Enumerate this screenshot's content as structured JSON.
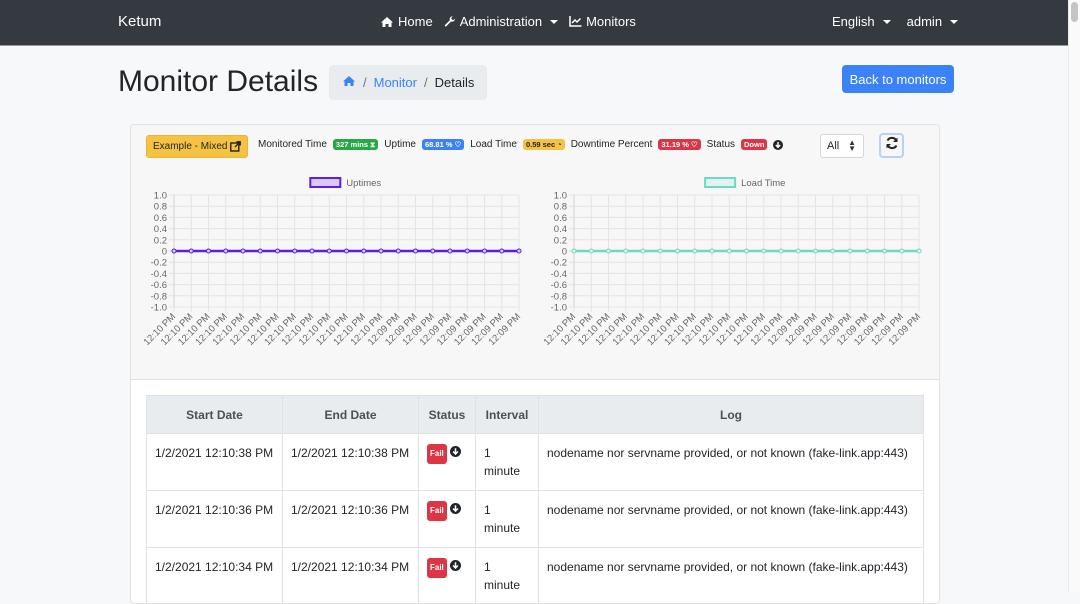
{
  "navbar": {
    "brand": "Ketum",
    "items": [
      {
        "label": "Home",
        "icon": "home-icon"
      },
      {
        "label": "Administration",
        "icon": "wrench-icon",
        "dropdown": true
      },
      {
        "label": "Monitors",
        "icon": "chart-line-icon"
      }
    ],
    "language": "English",
    "user": "admin"
  },
  "page": {
    "title": "Monitor Details",
    "breadcrumb": [
      {
        "label": "",
        "icon": "home-icon"
      },
      {
        "label": "Monitor"
      },
      {
        "label": "Details"
      }
    ],
    "back_button": "Back to monitors"
  },
  "monitor": {
    "name": "Example - Mixed",
    "stats": {
      "monitored_time_label": "Monitored Time",
      "monitored_time_value": "327 mins",
      "uptime_label": "Uptime",
      "uptime_value": "68.81 %",
      "load_time_label": "Load Time",
      "load_time_value": "0.59 sec",
      "downtime_label": "Downtime Percent",
      "downtime_value": "31.19 %",
      "status_label": "Status",
      "status_value": "Down"
    },
    "filter_selected": "All",
    "colors": {
      "uptime_line": "#5b1ee6",
      "uptime_fill": "#d8c9f7",
      "load_line": "#6ed8c4",
      "load_fill": "#dff4f0"
    }
  },
  "chart_data": [
    {
      "type": "line",
      "title": "",
      "legend": [
        "Uptimes"
      ],
      "legend_position": "top",
      "x": [
        "12:10 PM",
        "12:10 PM",
        "12:10 PM",
        "12:10 PM",
        "12:10 PM",
        "12:10 PM",
        "12:10 PM",
        "12:10 PM",
        "12:10 PM",
        "12:10 PM",
        "12:10 PM",
        "12:10 PM",
        "12:10 PM",
        "12:09 PM",
        "12:09 PM",
        "12:09 PM",
        "12:09 PM",
        "12:09 PM",
        "12:09 PM",
        "12:09 PM",
        "12:09 PM"
      ],
      "series": [
        {
          "name": "Uptimes",
          "values": [
            0,
            0,
            0,
            0,
            0,
            0,
            0,
            0,
            0,
            0,
            0,
            0,
            0,
            0,
            0,
            0,
            0,
            0,
            0,
            0,
            0
          ]
        }
      ],
      "ylim": [
        -1.0,
        1.0
      ],
      "yticks": [
        "1.0",
        "0.8",
        "0.6",
        "0.4",
        "0.2",
        "0",
        "-0.2",
        "-0.4",
        "-0.6",
        "-0.8",
        "-1.0"
      ],
      "grid": true,
      "xlabel": "",
      "ylabel": ""
    },
    {
      "type": "line",
      "title": "",
      "legend": [
        "Load Time"
      ],
      "legend_position": "top",
      "x": [
        "12:10 PM",
        "12:10 PM",
        "12:10 PM",
        "12:10 PM",
        "12:10 PM",
        "12:10 PM",
        "12:10 PM",
        "12:10 PM",
        "12:10 PM",
        "12:10 PM",
        "12:10 PM",
        "12:10 PM",
        "12:10 PM",
        "12:09 PM",
        "12:09 PM",
        "12:09 PM",
        "12:09 PM",
        "12:09 PM",
        "12:09 PM",
        "12:09 PM",
        "12:09 PM"
      ],
      "series": [
        {
          "name": "Load Time",
          "values": [
            0,
            0,
            0,
            0,
            0,
            0,
            0,
            0,
            0,
            0,
            0,
            0,
            0,
            0,
            0,
            0,
            0,
            0,
            0,
            0,
            0
          ]
        }
      ],
      "ylim": [
        -1.0,
        1.0
      ],
      "yticks": [
        "1.0",
        "0.8",
        "0.6",
        "0.4",
        "0.2",
        "0",
        "-0.2",
        "-0.4",
        "-0.6",
        "-0.8",
        "-1.0"
      ],
      "grid": true,
      "xlabel": "",
      "ylabel": ""
    }
  ],
  "table": {
    "headers": [
      "Start Date",
      "End Date",
      "Status",
      "Interval",
      "Log"
    ],
    "rows": [
      {
        "start": "1/2/2021 12:10:38 PM",
        "end": "1/2/2021 12:10:38 PM",
        "status": "Fail",
        "interval": "1 minute",
        "log": "nodename nor servname provided, or not known (fake-link.app:443)"
      },
      {
        "start": "1/2/2021 12:10:36 PM",
        "end": "1/2/2021 12:10:36 PM",
        "status": "Fail",
        "interval": "1 minute",
        "log": "nodename nor servname provided, or not known (fake-link.app:443)"
      },
      {
        "start": "1/2/2021 12:10:34 PM",
        "end": "1/2/2021 12:10:34 PM",
        "status": "Fail",
        "interval": "1 minute",
        "log": "nodename nor servname provided, or not known (fake-link.app:443)"
      }
    ]
  }
}
